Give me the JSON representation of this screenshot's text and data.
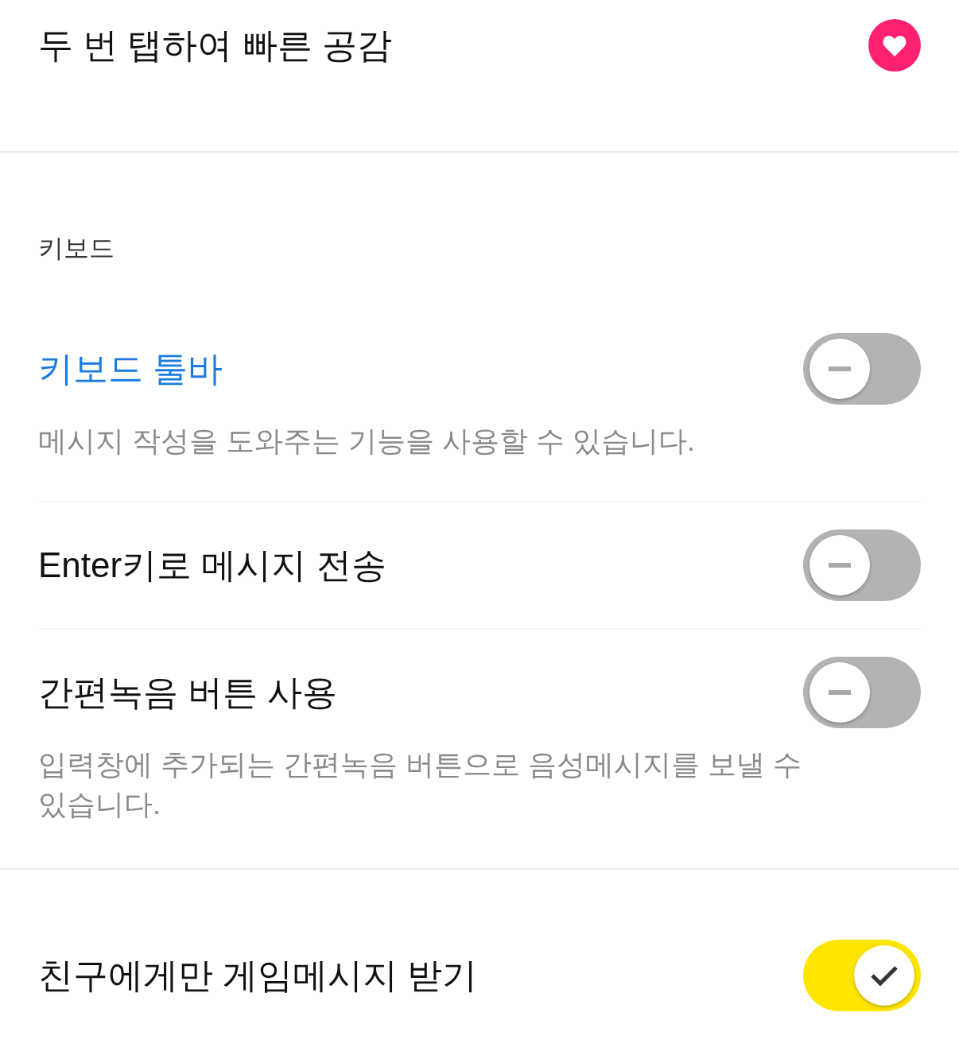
{
  "sections": [
    {
      "rows": [
        {
          "title": "두 번 탭하여 빠른 공감",
          "highlighted": false,
          "control": {
            "kind": "heart"
          }
        }
      ]
    },
    {
      "header": "키보드",
      "rows": [
        {
          "title": "키보드 툴바",
          "highlighted": true,
          "control": {
            "kind": "toggle",
            "on": false
          },
          "description": "메시지 작성을 도와주는 기능을 사용할 수 있습니다."
        },
        {
          "title": "Enter키로 메시지 전송",
          "highlighted": false,
          "control": {
            "kind": "toggle",
            "on": false
          }
        },
        {
          "title": "간편녹음 버튼 사용",
          "highlighted": false,
          "control": {
            "kind": "toggle",
            "on": false
          },
          "description": "입력창에 추가되는 간편녹음 버튼으로 음성메시지를 보낼 수 있습니다."
        }
      ]
    },
    {
      "rows": [
        {
          "title": "친구에게만 게임메시지 받기",
          "highlighted": false,
          "control": {
            "kind": "toggle",
            "on": true
          }
        }
      ]
    }
  ]
}
